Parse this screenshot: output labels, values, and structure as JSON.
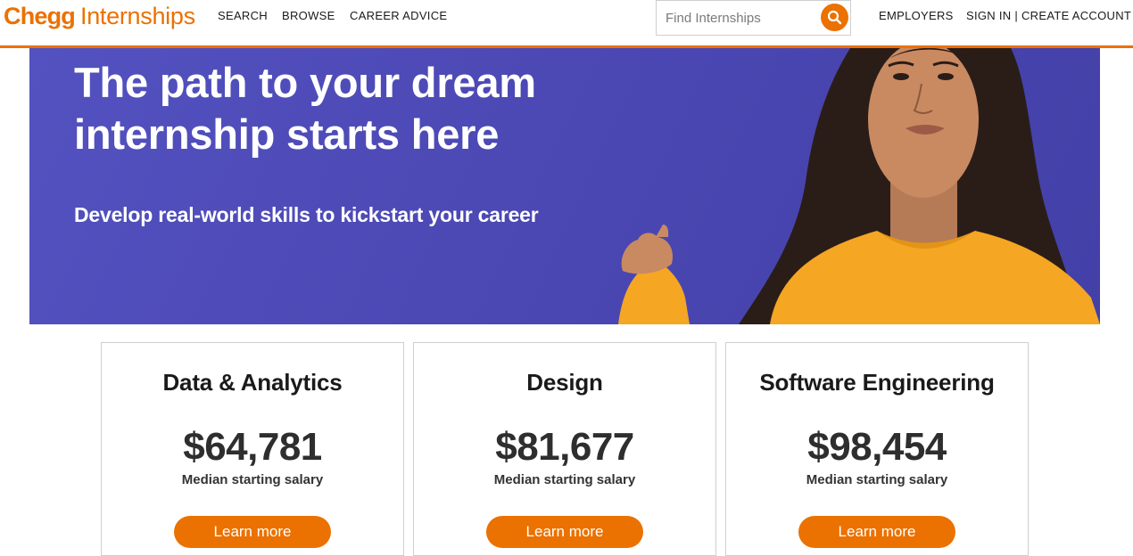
{
  "header": {
    "logo_brand": "Chegg",
    "logo_product": "Internships",
    "nav": {
      "search": "SEARCH",
      "browse": "BROWSE",
      "career_advice": "CAREER ADVICE",
      "employers": "EMPLOYERS",
      "sign_in": "SIGN IN | CREATE ACCOUNT"
    },
    "search": {
      "placeholder": "Find Internships",
      "value": ""
    }
  },
  "hero": {
    "title": "The path to your dream internship starts here",
    "subtitle": "Develop real-world skills to kickstart your career"
  },
  "cards": [
    {
      "title": "Data & Analytics",
      "salary": "$64,781",
      "caption": "Median starting salary",
      "button": "Learn more"
    },
    {
      "title": "Design",
      "salary": "$81,677",
      "caption": "Median starting salary",
      "button": "Learn more"
    },
    {
      "title": "Software Engineering",
      "salary": "$98,454",
      "caption": "Median starting salary",
      "button": "Learn more"
    }
  ],
  "colors": {
    "brand_orange": "#eb7100",
    "hero_purple": "#4c48b4",
    "sweater_yellow": "#f5a623",
    "text_dark": "#1a1a1a"
  },
  "icons": {
    "search_button": "magnifier-icon"
  }
}
